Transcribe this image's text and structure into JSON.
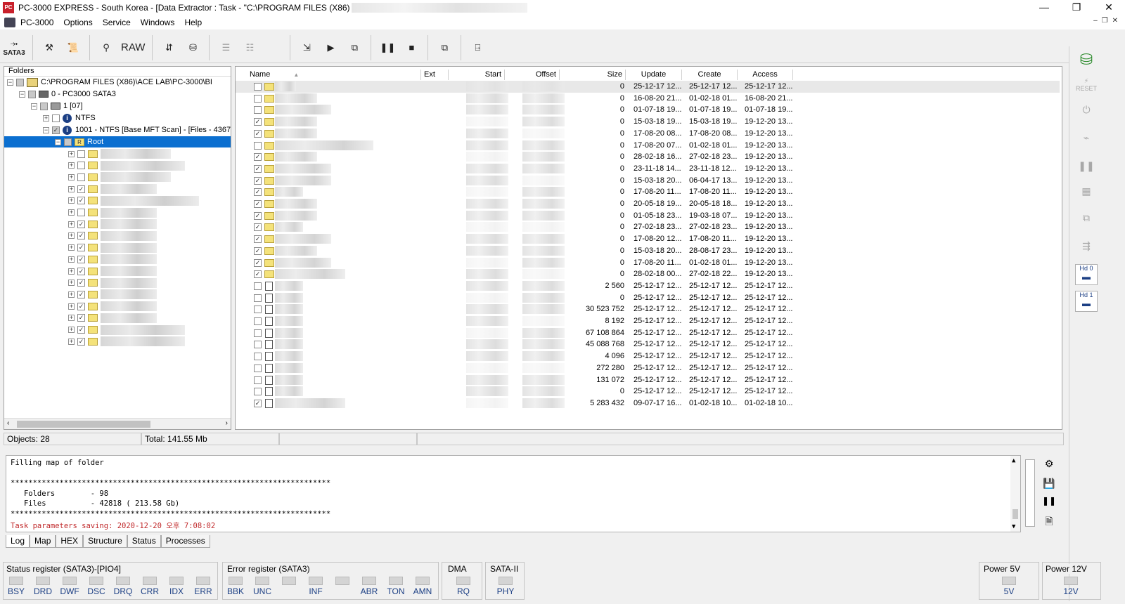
{
  "titlebar": {
    "app_icon": "pc3000-app-icon",
    "title": "PC-3000 EXPRESS - South Korea - [Data Extractor : Task - \"C:\\PROGRAM FILES (X86)",
    "minimize": "—",
    "restore": "❐",
    "close": "✕"
  },
  "menu": {
    "items": [
      "PC-3000",
      "Options",
      "Service",
      "Windows",
      "Help"
    ],
    "mdi_minimize": "–",
    "mdi_restore": "❐",
    "mdi_close": "✕"
  },
  "toolbar": {
    "sata_label": "SATA3",
    "raw_label": "RAW",
    "icons": [
      "sata-icon",
      "tools-icon",
      "scroll-icon",
      "binoculars-icon",
      "raw-icon",
      "transfer-icon",
      "drive-icon",
      "tree-icon",
      "tree-puzzle-icon",
      "export-icon",
      "play-icon",
      "network-icon",
      "pause-icon",
      "stop-icon",
      "windows-icon",
      "exit-icon"
    ]
  },
  "tree": {
    "header": "Folders",
    "root_path": "C:\\PROGRAM FILES (X86)\\ACE LAB\\PC-3000\\BI",
    "device": "0 - PC3000 SATA3",
    "drive": "1 [07]",
    "partition_ntfs": "NTFS",
    "partition_scan": "1001 - NTFS [Base MFT Scan] - [Files - 4367",
    "root_label": "Root",
    "root_badge": "R",
    "subfolders_checked": [
      false,
      false,
      false,
      true,
      true,
      false,
      true,
      true,
      true,
      true,
      true,
      true,
      true,
      true,
      true,
      true,
      true
    ]
  },
  "grid": {
    "columns": {
      "name": "Name",
      "ext": "Ext",
      "start": "Start",
      "offset": "Offset",
      "size": "Size",
      "update": "Update",
      "create": "Create",
      "access": "Access"
    },
    "rows": [
      {
        "type": "folder",
        "checked": false,
        "size": "0",
        "update": "25-12-17 12...",
        "create": "25-12-17 12...",
        "access": "25-12-17 12..."
      },
      {
        "type": "folder",
        "checked": false,
        "size": "0",
        "update": "16-08-20 21...",
        "create": "01-02-18 01...",
        "access": "16-08-20 21..."
      },
      {
        "type": "folder",
        "checked": false,
        "size": "0",
        "update": "01-07-18 19...",
        "create": "01-07-18 19...",
        "access": "01-07-18 19..."
      },
      {
        "type": "folder",
        "checked": true,
        "size": "0",
        "update": "15-03-18 19...",
        "create": "15-03-18 19...",
        "access": "19-12-20 13..."
      },
      {
        "type": "folder",
        "checked": true,
        "size": "0",
        "update": "17-08-20 08...",
        "create": "17-08-20 08...",
        "access": "19-12-20 13..."
      },
      {
        "type": "folder",
        "checked": false,
        "size": "0",
        "update": "17-08-20 07...",
        "create": "01-02-18 01...",
        "access": "19-12-20 13..."
      },
      {
        "type": "folder",
        "checked": true,
        "size": "0",
        "update": "28-02-18 16...",
        "create": "27-02-18 23...",
        "access": "19-12-20 13..."
      },
      {
        "type": "folder",
        "checked": true,
        "size": "0",
        "update": "23-11-18 14...",
        "create": "23-11-18 12...",
        "access": "19-12-20 13..."
      },
      {
        "type": "folder",
        "checked": true,
        "size": "0",
        "update": "15-03-18 20...",
        "create": "06-04-17 13...",
        "access": "19-12-20 13..."
      },
      {
        "type": "folder",
        "checked": true,
        "size": "0",
        "update": "17-08-20 11...",
        "create": "17-08-20 11...",
        "access": "19-12-20 13..."
      },
      {
        "type": "folder",
        "checked": true,
        "size": "0",
        "update": "20-05-18 19...",
        "create": "20-05-18 18...",
        "access": "19-12-20 13..."
      },
      {
        "type": "folder",
        "checked": true,
        "size": "0",
        "update": "01-05-18 23...",
        "create": "19-03-18 07...",
        "access": "19-12-20 13..."
      },
      {
        "type": "folder",
        "checked": true,
        "size": "0",
        "update": "27-02-18 23...",
        "create": "27-02-18 23...",
        "access": "19-12-20 13..."
      },
      {
        "type": "folder",
        "checked": true,
        "size": "0",
        "update": "17-08-20 12...",
        "create": "17-08-20 11...",
        "access": "19-12-20 13..."
      },
      {
        "type": "folder",
        "checked": true,
        "size": "0",
        "update": "15-03-18 20...",
        "create": "28-08-17 23...",
        "access": "19-12-20 13..."
      },
      {
        "type": "folder",
        "checked": true,
        "size": "0",
        "update": "17-08-20 11...",
        "create": "01-02-18 01...",
        "access": "19-12-20 13..."
      },
      {
        "type": "folder",
        "checked": true,
        "size": "0",
        "update": "28-02-18 00...",
        "create": "27-02-18 22...",
        "access": "19-12-20 13..."
      },
      {
        "type": "file",
        "checked": false,
        "size": "2 560",
        "update": "25-12-17 12...",
        "create": "25-12-17 12...",
        "access": "25-12-17 12..."
      },
      {
        "type": "file",
        "checked": false,
        "size": "0",
        "update": "25-12-17 12...",
        "create": "25-12-17 12...",
        "access": "25-12-17 12..."
      },
      {
        "type": "file",
        "checked": false,
        "size": "30 523 752",
        "update": "25-12-17 12...",
        "create": "25-12-17 12...",
        "access": "25-12-17 12..."
      },
      {
        "type": "file",
        "checked": false,
        "size": "8 192",
        "update": "25-12-17 12...",
        "create": "25-12-17 12...",
        "access": "25-12-17 12..."
      },
      {
        "type": "file",
        "checked": false,
        "size": "67 108 864",
        "update": "25-12-17 12...",
        "create": "25-12-17 12...",
        "access": "25-12-17 12..."
      },
      {
        "type": "file",
        "checked": false,
        "size": "45 088 768",
        "update": "25-12-17 12...",
        "create": "25-12-17 12...",
        "access": "25-12-17 12..."
      },
      {
        "type": "file",
        "checked": false,
        "size": "4 096",
        "update": "25-12-17 12...",
        "create": "25-12-17 12...",
        "access": "25-12-17 12..."
      },
      {
        "type": "file",
        "checked": false,
        "size": "272 280",
        "update": "25-12-17 12...",
        "create": "25-12-17 12...",
        "access": "25-12-17 12..."
      },
      {
        "type": "file",
        "checked": false,
        "size": "131 072",
        "update": "25-12-17 12...",
        "create": "25-12-17 12...",
        "access": "25-12-17 12..."
      },
      {
        "type": "file",
        "checked": false,
        "size": "0",
        "update": "25-12-17 12...",
        "create": "25-12-17 12...",
        "access": "25-12-17 12..."
      },
      {
        "type": "file",
        "checked": true,
        "size": "5 283 432",
        "update": "09-07-17 16...",
        "create": "01-02-18 10...",
        "access": "01-02-18 10..."
      }
    ]
  },
  "status": {
    "objects": "Objects: 28",
    "total": "Total: 141.55 Mb"
  },
  "log": {
    "lines": [
      {
        "text": "Filling map of folder",
        "red": false
      },
      {
        "text": "",
        "red": false
      },
      {
        "text": "************************************************************************",
        "red": false
      },
      {
        "text": "   Folders        - 98",
        "red": false
      },
      {
        "text": "   Files          - 42818 ( 213.58 Gb)",
        "red": false
      },
      {
        "text": "************************************************************************",
        "red": false
      },
      {
        "text": "Task parameters saving: 2020-12-20 오후 7:08:02",
        "red": true
      }
    ],
    "side_icons": [
      "settings-doc-icon",
      "save-icon",
      "pause-icon",
      "save-as-icon"
    ]
  },
  "tabs": [
    "Log",
    "Map",
    "HEX",
    "Structure",
    "Status",
    "Processes"
  ],
  "sidebar": {
    "hd0": "Hd 0",
    "hd1": "Hd 1",
    "reset": "RESET"
  },
  "registers": {
    "status_title": "Status register (SATA3)-[PIO4]",
    "status_bits": [
      "BSY",
      "DRD",
      "DWF",
      "DSC",
      "DRQ",
      "CRR",
      "IDX",
      "ERR"
    ],
    "error_title": "Error register (SATA3)",
    "error_bits": [
      "BBK",
      "UNC",
      "",
      "INF",
      "",
      "ABR",
      "TON",
      "AMN"
    ],
    "dma_title": "DMA",
    "dma_bit": "RQ",
    "sata_title": "SATA-II",
    "sata_bit": "PHY",
    "p5_title": "Power 5V",
    "p5_bit": "5V",
    "p12_title": "Power 12V",
    "p12_bit": "12V"
  },
  "colors": {
    "selection": "#0b6fd0",
    "led_label": "#1c3f84",
    "log_red": "#c0282a",
    "folder": "#f4e27a"
  }
}
